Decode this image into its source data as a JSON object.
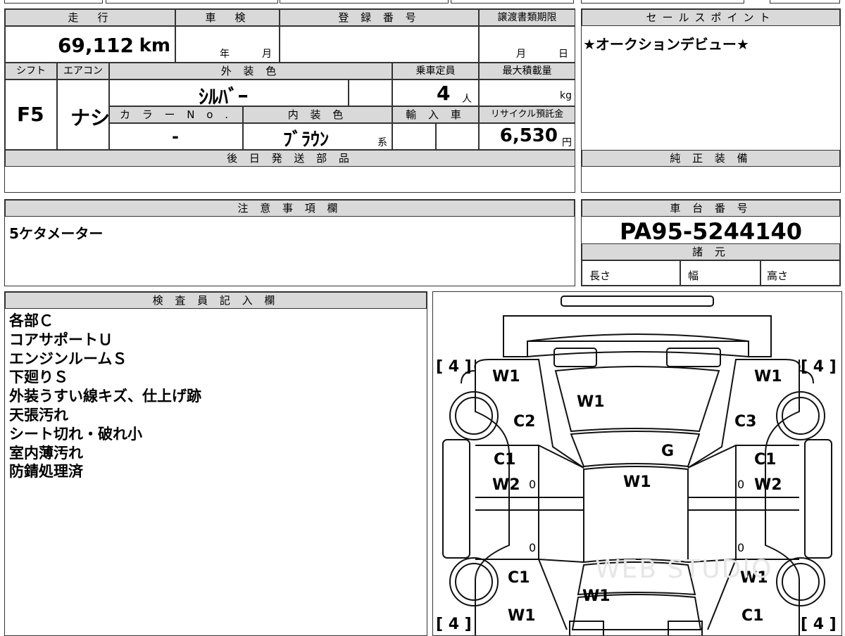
{
  "summary": {
    "mileage_label": "走　行",
    "mileage_value": "69,112",
    "mileage_unit": "km",
    "inspection_label": "車　検",
    "inspection_year": "年",
    "inspection_month": "月",
    "registration_label": "登 録 番 号",
    "transfer_label": "譲渡書類期限",
    "transfer_month": "月",
    "transfer_day": "日",
    "shift_label": "シフト",
    "shift_value": "F5",
    "aircon_label": "エアコン",
    "aircon_value": "ナシ",
    "exterior_label": "外 装 色",
    "exterior_value": "ｼﾙﾊﾞｰ",
    "capacity_label": "乗車定員",
    "capacity_value": "4",
    "capacity_unit": "人",
    "maxload_label": "最大積載量",
    "maxload_unit": "kg",
    "color_no_label": "カ ラ ー N o .",
    "color_no_value": "-",
    "interior_label": "内 装 色",
    "interior_value": "ﾌﾞﾗｳﾝ",
    "interior_suffix": "系",
    "import_label": "輸 入 車",
    "recycle_label": "リサイクル預託金",
    "recycle_value": "6,530",
    "recycle_unit": "円",
    "later_parts_label": "後 日 発 送 部 品"
  },
  "sales": {
    "label": "セールスポイント",
    "text": "★オークションデビュー★"
  },
  "genuine": {
    "label": "純 正 装 備"
  },
  "notes": {
    "label": "注 意 事 項 欄",
    "text": "5ケタメーター"
  },
  "chassis": {
    "label": "車 台 番 号",
    "value": "PA95-5244140",
    "specs_label": "諸 元",
    "length_label": "長さ",
    "width_label": "幅",
    "height_label": "高さ"
  },
  "inspector": {
    "label": "検 査 員 記 入 欄",
    "lines": [
      "各部Ｃ",
      "コアサポートＵ",
      "エンジンルームＳ",
      "下廻りＳ",
      "外装うすい線キズ、仕上げ跡",
      "天張汚れ",
      "シート切れ・破れ小",
      "室内薄汚れ",
      "防錆処理済"
    ]
  },
  "diagram": {
    "tire_fl": "[ 4 ]",
    "tire_fr": "[ 4 ]",
    "tire_rl": "[ 4 ]",
    "tire_rr": "[ 4 ]",
    "marks": {
      "front_left_fender": "W1",
      "front_right_fender": "W1",
      "hood": "W1",
      "front_left_door_area": "C2",
      "front_right_door_area": "C3",
      "windshield": "G",
      "left_front_door": "C1",
      "left_front_door_2": "W2",
      "right_front_door": "C1",
      "right_front_door_2": "W2",
      "roof": "W1",
      "left_rear_quarter": "C1",
      "right_rear_quarter": "W1",
      "trunk": "W1",
      "left_rear_bottom": "W1",
      "right_rear_bottom": "C1",
      "left_zero_1": "0",
      "left_zero_2": "0",
      "right_zero_1": "0",
      "right_zero_2": "0"
    },
    "watermark": "WEB STUDIO"
  }
}
